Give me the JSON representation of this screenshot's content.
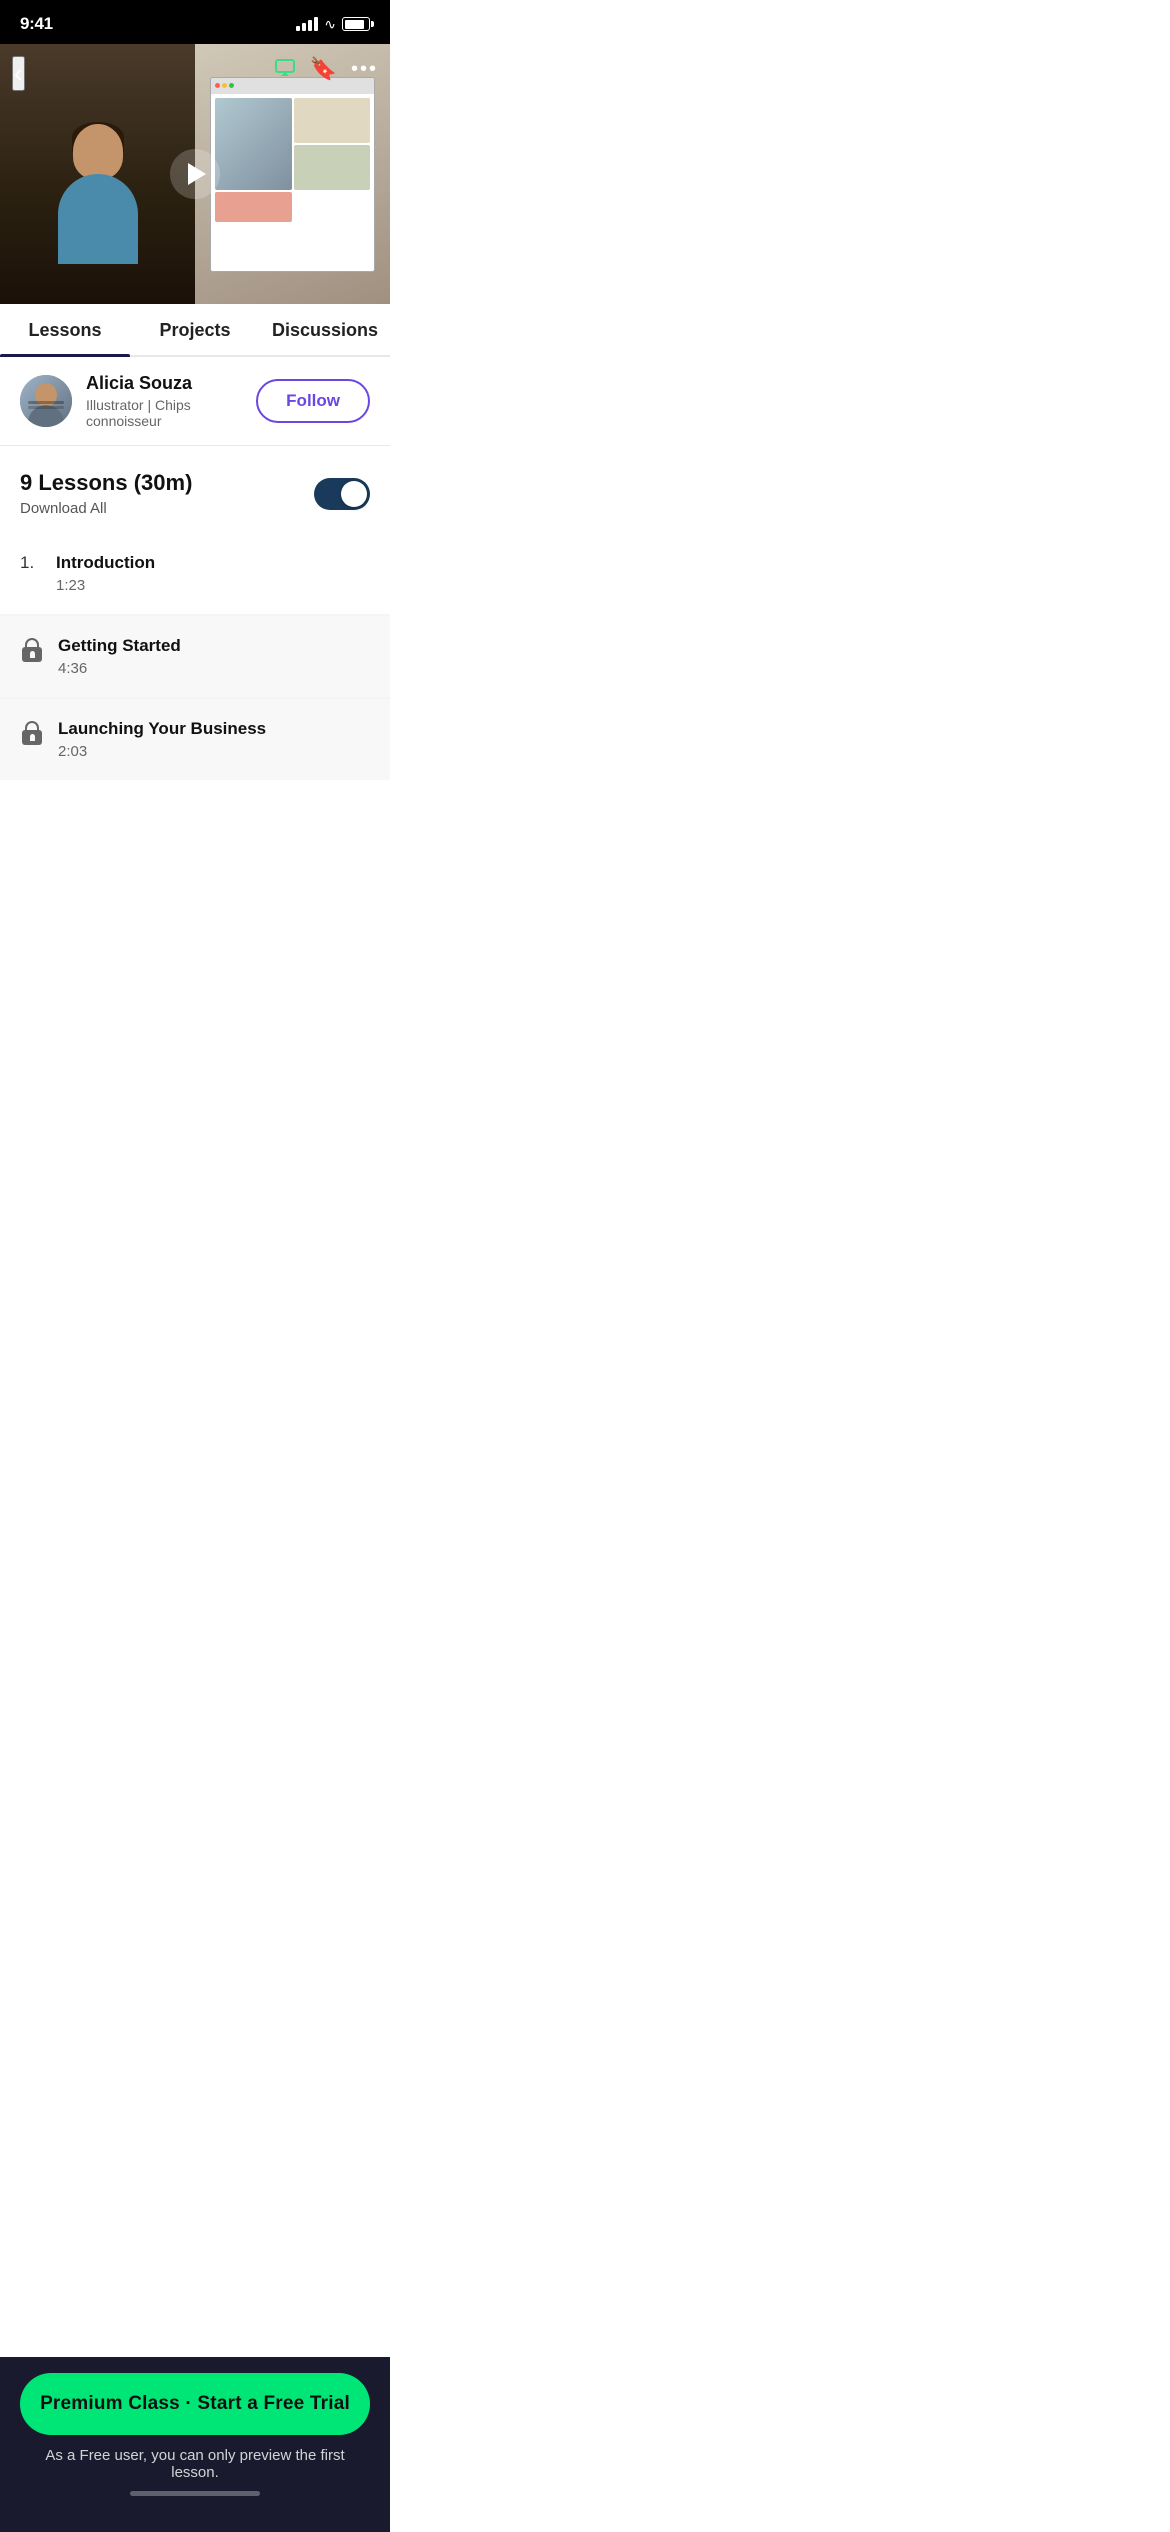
{
  "statusBar": {
    "time": "9:41"
  },
  "videoArea": {
    "backLabel": "‹"
  },
  "tabs": [
    {
      "id": "lessons",
      "label": "Lessons",
      "active": true
    },
    {
      "id": "projects",
      "label": "Projects",
      "active": false
    },
    {
      "id": "discussions",
      "label": "Discussions",
      "active": false
    }
  ],
  "instructor": {
    "name": "Alicia Souza",
    "bio": "Illustrator | Chips connoisseur",
    "followLabel": "Follow"
  },
  "lessonsSection": {
    "title": "9 Lessons (30m)",
    "downloadLabel": "Download All"
  },
  "lessons": [
    {
      "number": "1.",
      "name": "Introduction",
      "duration": "1:23",
      "locked": false
    },
    {
      "number": "",
      "name": "Getting Started",
      "duration": "4:36",
      "locked": true
    },
    {
      "number": "",
      "name": "Launching Your Business",
      "duration": "2:03",
      "locked": true
    }
  ],
  "cta": {
    "buttonLabel": "Premium Class · Start a Free Trial",
    "subtext": "As a Free user, you can only preview the first lesson."
  }
}
